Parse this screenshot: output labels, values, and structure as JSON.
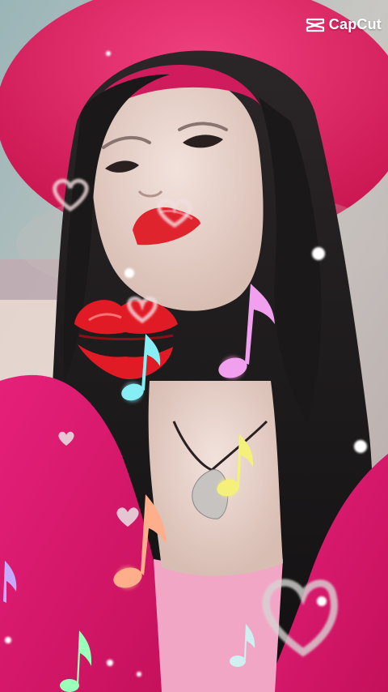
{
  "watermark": {
    "logo_icon": "capcut-logo-icon",
    "text": "CapCut",
    "color": "#ffffff"
  },
  "effects": {
    "stickers": [
      "lips-sticker-icon",
      "heart-outline-icon",
      "music-note-icon",
      "sparkle-dot-icon"
    ],
    "note_colors": [
      "#ff8fe0",
      "#7ef0ff",
      "#f7f27a",
      "#ffb08a",
      "#9affb8",
      "#c6a8ff"
    ],
    "accent_pink": "#e5176f",
    "lip_red": "#e0242e"
  }
}
